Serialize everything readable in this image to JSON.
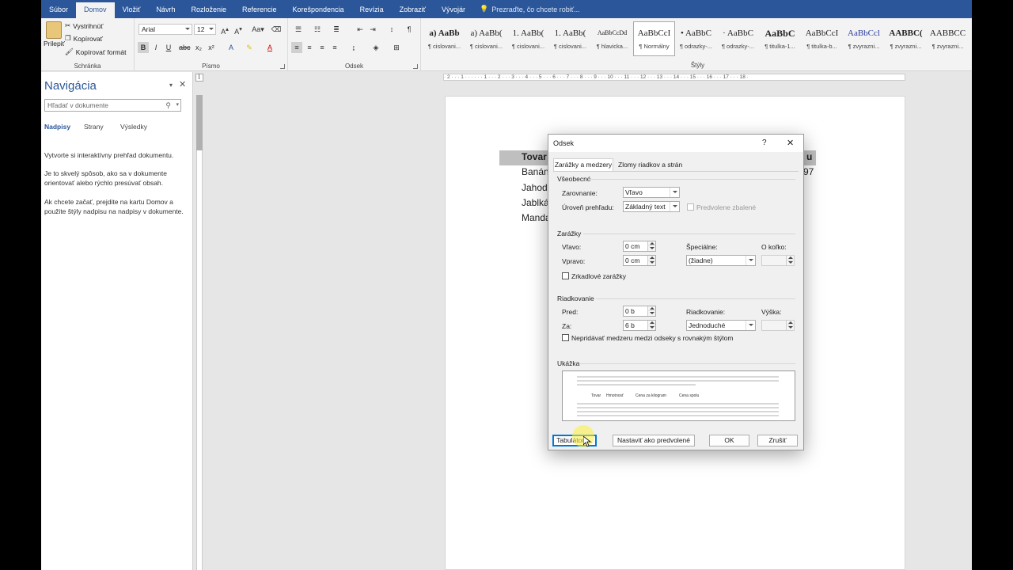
{
  "tabs": [
    "Súbor",
    "Domov",
    "Vložiť",
    "Návrh",
    "Rozloženie",
    "Referencie",
    "Korešpondencia",
    "Revízia",
    "Zobraziť",
    "Vývojár"
  ],
  "tell_me": "Prezraďte, čo chcete robiť...",
  "clipboard": {
    "paste": "Prilepiť",
    "cut": "Vystrihnúť",
    "copy": "Kopírovať",
    "format_painter": "Kopírovať formát",
    "label": "Schránka"
  },
  "font": {
    "name": "Arial",
    "size": "12",
    "label": "Písmo"
  },
  "paragraph_label": "Odsek",
  "styles_label": "Štýly",
  "styles": [
    {
      "sample": "a) AaBb",
      "name": "¶ cislovani..."
    },
    {
      "sample": "a) AaBb(",
      "name": "¶ cislovani..."
    },
    {
      "sample": "1. AaBb(",
      "name": "¶ cislovani..."
    },
    {
      "sample": "1. AaBb(",
      "name": "¶ cislovani..."
    },
    {
      "sample": "AaBbCcDd",
      "name": "¶ hlavicka..."
    },
    {
      "sample": "AaBbCcI",
      "name": "¶ Normálny"
    },
    {
      "sample": "• AaBbC",
      "name": "¶ odrazky-..."
    },
    {
      "sample": "· AaBbC",
      "name": "¶ odrazky-..."
    },
    {
      "sample": "AaBbC",
      "name": "¶ titulka-1..."
    },
    {
      "sample": "AaBbCcI",
      "name": "¶ titulka-b..."
    },
    {
      "sample": "AaBbCcl",
      "name": "¶ zvyrazni..."
    },
    {
      "sample": "AABBC(",
      "name": "¶ zvyrazni..."
    },
    {
      "sample": "AABBCC",
      "name": "¶ zvyrazni..."
    }
  ],
  "nav": {
    "title": "Navigácia",
    "search_placeholder": "Hľadať v dokumente",
    "tabs": [
      "Nadpisy",
      "Strany",
      "Výsledky"
    ],
    "p1": "Vytvorte si interaktívny prehľad dokumentu.",
    "p2": "Je to skvelý spôsob, ako sa v dokumente orientovať alebo rýchlo presúvať obsah.",
    "p3": "Ak chcete začať, prejdite na kartu Domov a použite štýly nadpisu na nadpisy v dokumente."
  },
  "ruler": "· 2 · · · 1 · · · · · · 1 · · · 2 · · · 3 · · · 4 · · · 5 · · · 6 · · · 7 · · · 8 · · · 9 · · · 10 · · · 11 · · · 12 · · · 13 · · · 14 · · · 15 · · · 16 · · · 17 · · · 18 ·",
  "doc": {
    "header_left": "Tovar",
    "header_right": "u",
    "rows": [
      "Banán",
      "Jahody",
      "Jablká",
      "Manda"
    ],
    "row1_right": "97"
  },
  "dialog": {
    "title": "Odsek",
    "help": "?",
    "close": "✕",
    "tabs": [
      "Zarážky a medzery",
      "Zlomy riadkov a strán"
    ],
    "general": "Všeobecné",
    "alignment_label": "Zarovnanie:",
    "alignment_value": "Vľavo",
    "outline_label": "Úroveň prehľadu:",
    "outline_value": "Základný text",
    "collapsed_label": "Predvolene zbalené",
    "indent": "Zarážky",
    "left_label": "Vľavo:",
    "left_value": "0 cm",
    "right_label": "Vpravo:",
    "right_value": "0 cm",
    "special_label": "Špeciálne:",
    "special_value": "(žiadne)",
    "by_label": "O koľko:",
    "mirror_label": "Zrkadlové zarážky",
    "spacing": "Riadkovanie",
    "before_label": "Pred:",
    "before_value": "0 b",
    "after_label": "Za:",
    "after_value": "6 b",
    "line_label": "Riadkovanie:",
    "line_value": "Jednoduché",
    "at_label": "Výška:",
    "no_space_label": "Nepridávať medzeru medzi odseky s rovnakým štýlom",
    "preview": "Ukážka",
    "preview_words": [
      "Tovar",
      "Hmotnosť",
      "Cena za kilogram",
      "Cena spolu"
    ],
    "tabs_button": "Tabulátory...",
    "default_button": "Nastaviť ako predvolené",
    "ok_button": "OK",
    "cancel_button": "Zrušiť"
  }
}
